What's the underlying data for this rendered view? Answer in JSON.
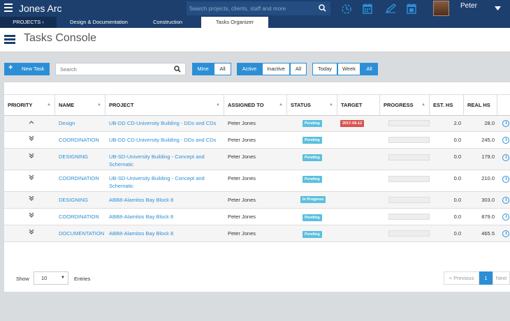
{
  "header": {
    "app_title": "Jones Arc",
    "search_placeholder": "Search projects, clients, staff and more",
    "user_name": "Peter"
  },
  "nav": {
    "projects_label": "PROJECTS  ›",
    "tabs": [
      "Design & Documentation",
      "Construction",
      "Tasks Organizer"
    ]
  },
  "page": {
    "title": "Tasks Console"
  },
  "toolbar": {
    "new_task_label": "New Task",
    "search_placeholder": "Search",
    "mine_label": "Mine",
    "all_label": "All",
    "active_label": "Active",
    "inactive_label": "Inactive",
    "today_label": "Today",
    "week_label": "Week",
    "accent": "#2c8fd6"
  },
  "table": {
    "headers": [
      "PRIORITY",
      "NAME",
      "PROJECT",
      "ASSIGNED TO",
      "STATUS",
      "TARGET",
      "PROGRESS",
      "EST. HS",
      "REAL HS"
    ],
    "rows": [
      {
        "priority_icon": "chevron-up",
        "name": "Design",
        "project": "UB-DD CD-University Building - DDs and CDs",
        "project2": "",
        "assigned": "Peter Jones",
        "status": "Pending",
        "target": "2017-09-12",
        "est": "2.0",
        "real": "28.0"
      },
      {
        "priority_icon": "double-chevron-down",
        "name": "COORDINATION",
        "project": "UB-DD CD-University Building - DDs and CDs",
        "project2": "",
        "assigned": "Peter Jones",
        "status": "Pending",
        "target": "",
        "est": "0.0",
        "real": "245.0"
      },
      {
        "priority_icon": "double-chevron-down",
        "name": "DESIGNING",
        "project": "UB-SD-University Building - Concept and",
        "project2": "Schematic",
        "assigned": "Peter Jones",
        "status": "Pending",
        "target": "",
        "est": "0.0",
        "real": "179.0"
      },
      {
        "priority_icon": "double-chevron-down",
        "name": "COORDINATION",
        "project": "UB-SD-University Building - Concept and",
        "project2": "Schematic",
        "assigned": "Peter Jones",
        "status": "Pending",
        "target": "",
        "est": "0.0",
        "real": "210.0"
      },
      {
        "priority_icon": "double-chevron-down",
        "name": "DESIGNING",
        "project": "ABB8-Alamitos Bay Block 8",
        "project2": "",
        "assigned": "Peter Jones",
        "status": "In Progress",
        "target": "",
        "est": "0.0",
        "real": "303.0"
      },
      {
        "priority_icon": "double-chevron-down",
        "name": "COORDINATION",
        "project": "ABB8-Alamitos Bay Block 8",
        "project2": "",
        "assigned": "Peter Jones",
        "status": "Pending",
        "target": "",
        "est": "0.0",
        "real": "879.0"
      },
      {
        "priority_icon": "double-chevron-down",
        "name": "DOCUMENTATION",
        "project": "ABB8-Alamitos Bay Block 8",
        "project2": "",
        "assigned": "Peter Jones",
        "status": "Pending",
        "target": "",
        "est": "0.0",
        "real": "465.5"
      }
    ]
  },
  "footer": {
    "show_label": "Show",
    "page_size": "10",
    "entries_label": "Entries",
    "prev_label": "< Previous",
    "current_page": "1",
    "next_label": "Next"
  }
}
